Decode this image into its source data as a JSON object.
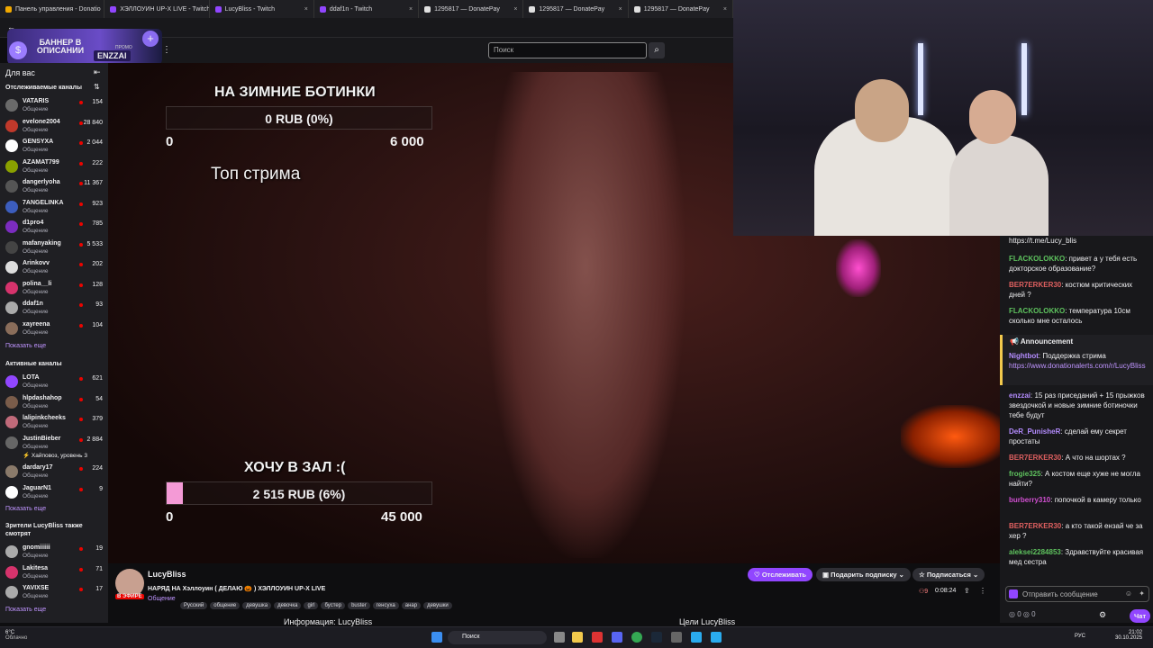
{
  "browser": {
    "tabs": [
      {
        "label": "Панель управления - Donatio",
        "color": "#f2a900"
      },
      {
        "label": "ХЭЛЛОУИН UP-X LIVE - Twitch",
        "color": "#9146ff"
      },
      {
        "label": "LucyBliss - Twitch",
        "color": "#9146ff"
      },
      {
        "label": "ddaf1n - Twitch",
        "color": "#9146ff"
      },
      {
        "label": "1295817 — DonatePay",
        "color": "#e0e0e0"
      },
      {
        "label": "1295817 — DonatePay",
        "color": "#e0e0e0"
      },
      {
        "label": "1295817 — DonatePay",
        "color": "#e0e0e0"
      }
    ]
  },
  "header": {
    "search_placeholder": "Поиск",
    "banner_text": "БАННЕР В ОПИСАНИИ",
    "banner_promo": "ENZZAI",
    "banner_promo_label": "ПРОМО"
  },
  "sidebar": {
    "for_you": "Для вас",
    "followed_title": "Отслеживаемые каналы",
    "followed": [
      {
        "name": "VATARIS",
        "cat": "Общение",
        "viewers": "154",
        "color": "#6a6a6a"
      },
      {
        "name": "evelone2004",
        "cat": "Общение",
        "viewers": "28 840",
        "color": "#c0392b"
      },
      {
        "name": "GENSYXA",
        "cat": "Общение",
        "viewers": "2 044",
        "color": "#ffffff"
      },
      {
        "name": "AZAMAT799",
        "cat": "Общение",
        "viewers": "222",
        "color": "#8aa000"
      },
      {
        "name": "dangerlyoha",
        "cat": "Общение",
        "viewers": "11 367",
        "color": "#555"
      },
      {
        "name": "7ANGELINKA",
        "cat": "Общение",
        "viewers": "923",
        "color": "#3c5dbd"
      },
      {
        "name": "d1pro4",
        "cat": "Общение",
        "viewers": "785",
        "color": "#7b2cbf"
      },
      {
        "name": "mafanyaking",
        "cat": "Общение",
        "viewers": "5 533",
        "color": "#444"
      },
      {
        "name": "Arinkovv",
        "cat": "Общение",
        "viewers": "202",
        "color": "#ddd"
      },
      {
        "name": "polina__li",
        "cat": "Общение",
        "viewers": "128",
        "color": "#d6336c"
      },
      {
        "name": "ddaf1n",
        "cat": "Общение",
        "viewers": "93",
        "color": "#aaa"
      },
      {
        "name": "xayreena",
        "cat": "Общение",
        "viewers": "104",
        "color": "#8a6d5a"
      }
    ],
    "show_more_1": "Показать еще",
    "active_title": "Активные каналы",
    "active": [
      {
        "name": "LOTA",
        "cat": "Общение",
        "viewers": "621",
        "color": "#9146ff"
      },
      {
        "name": "hlpdashahop",
        "cat": "Общение",
        "viewers": "54",
        "color": "#7a5c4a"
      },
      {
        "name": "lalipinkcheeks",
        "cat": "Общение",
        "viewers": "379",
        "color": "#c06a7a"
      },
      {
        "name": "JustinBieber",
        "cat": "Общение",
        "viewers": "2 884",
        "color": "#666",
        "extra": "Хайповоз, уровень 3"
      },
      {
        "name": "dardary17",
        "cat": "Общение",
        "viewers": "224",
        "color": "#8a7a6a"
      },
      {
        "name": "JaguarN1",
        "cat": "Общение",
        "viewers": "9",
        "color": "#fff"
      }
    ],
    "show_more_2": "Показать еще",
    "related_title": "Зрители LucyBliss также смотрят",
    "related": [
      {
        "name": "gnomiiiiii",
        "cat": "Общение",
        "viewers": "19",
        "color": "#aaa"
      },
      {
        "name": "Lakitesa",
        "cat": "Общение",
        "viewers": "71",
        "color": "#d6336c"
      },
      {
        "name": "YAVIXSE",
        "cat": "Общение",
        "viewers": "17",
        "color": "#aaa"
      }
    ],
    "show_more_3": "Показать еще"
  },
  "overlay": {
    "goal1_title": "НА ЗИМНИЕ БОТИНКИ",
    "goal1_amount": "0 RUB (0%)",
    "goal1_min": "0",
    "goal1_max": "6 000",
    "goal1_progress": 0,
    "top_label": "Топ стрима",
    "goal2_title": "ХОЧУ В ЗАЛ :(",
    "goal2_amount": "2 515 RUB (6%)",
    "goal2_min": "0",
    "goal2_max": "45 000",
    "goal2_progress": 0.06
  },
  "stream": {
    "channel": "LucyBliss",
    "title": "НАРЯД НА Хэллоуин ( ДЕЛАЮ 🎃 ) ХЭЛЛОУИН UP-X LIVE",
    "live_badge": "В ЭФИРЕ",
    "category": "Общение",
    "tags": [
      "Русский",
      "общение",
      "девушка",
      "девочка",
      "girl",
      "бустер",
      "buster",
      "генсуха",
      "анар",
      "девушки"
    ],
    "follow_label": "Отслеживать",
    "gift_label": "Подарить подписку",
    "subscribe_label": "Подписаться",
    "viewers": "9",
    "uptime": "0:08:24",
    "about_label": "Информация: LucyBliss",
    "goals_label": "Цели LucyBliss"
  },
  "chat": {
    "link": "https://t.me/Lucy_blis",
    "messages": [
      {
        "user": "FLACKOLOKKO",
        "color": "#5ec25e",
        "text": "привет а у тебя есть докторское образование?"
      },
      {
        "user": "BER7ERKER30",
        "color": "#e06060",
        "text": "костюм критических дней ?"
      },
      {
        "user": "FLACKOLOKKO",
        "color": "#5ec25e",
        "text": "температура 10см сколько мне осталось"
      }
    ],
    "announcement_label": "Announcement",
    "announcement_user": "Nightbot",
    "announcement_text": "Поддержка стрима",
    "announcement_link": "https://www.donationalerts.com/r/LucyBliss",
    "messages2": [
      {
        "user": "enzzai",
        "color": "#b48cff",
        "text": "15 раз приседаний + 15 прыжков звездочкой и новые зимние ботиночки тебе будут"
      },
      {
        "user": "DeR_PunisheR",
        "color": "#b48cff",
        "text": "сделай ему секрет простаты"
      },
      {
        "user": "BER7ERKER30",
        "color": "#e06060",
        "text": "А что на шортах ?"
      },
      {
        "user": "frogie325",
        "color": "#5ec25e",
        "text": "А костом еще хуже не могла найти?"
      },
      {
        "user": "burberry310",
        "color": "#d04fd0",
        "text": "попочкой в камеру только"
      },
      {
        "user": "BER7ERKER30",
        "color": "#e06060",
        "text": "а кто такой ензай че за хер ?"
      },
      {
        "user": "aleksei2284853",
        "color": "#5ec25e",
        "text": "Здравствуйте красивая мед сестра"
      }
    ],
    "input_placeholder": "Отправить сообщение",
    "points1": "0",
    "points2": "0",
    "send_label": "Чат"
  },
  "taskbar": {
    "weather_temp": "6°C",
    "weather_desc": "Облачно",
    "search_label": "Поиск",
    "lang": "РУС",
    "time": "21:02",
    "date": "30.10.2025"
  }
}
